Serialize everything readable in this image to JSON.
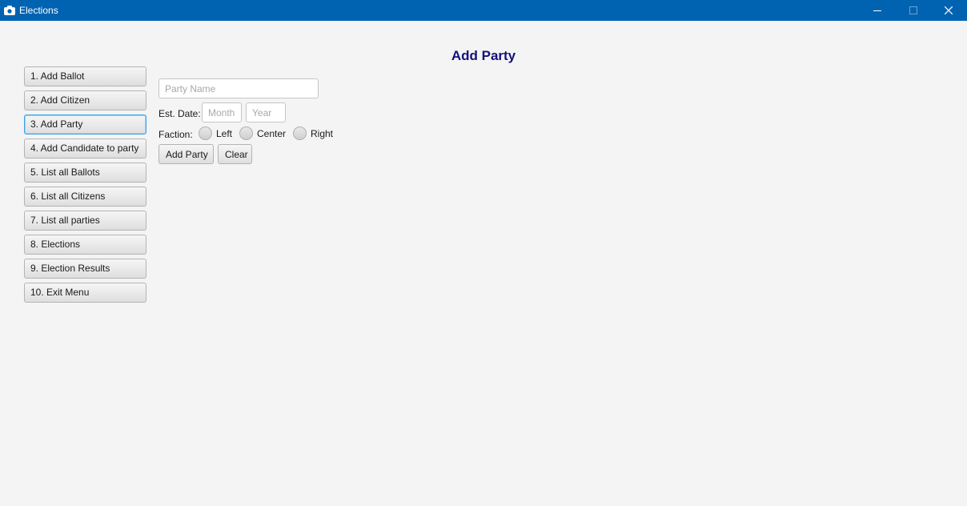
{
  "window": {
    "title": "Elections",
    "accent_color": "#0063b1",
    "icons": [
      "app-icon",
      "minimize-icon",
      "maximize-icon",
      "close-icon"
    ]
  },
  "heading": "Add Party",
  "menu": {
    "items": [
      "1. Add Ballot",
      "2. Add Citizen",
      "3. Add Party",
      "4. Add Candidate to party",
      "5. List all Ballots",
      "6. List all Citizens",
      "7. List all parties",
      "8. Elections",
      "9. Election Results",
      "10. Exit Menu"
    ],
    "active_item": "3. Add Party"
  },
  "form": {
    "party_name_placeholder": "Party Name",
    "est_date_label": "Est. Date:",
    "month_placeholder": "Month",
    "year_placeholder": "Year",
    "faction_label": "Faction:",
    "factions": [
      "Left",
      "Center",
      "Right"
    ],
    "add_button": "Add Party",
    "clear_button": "Clear"
  }
}
